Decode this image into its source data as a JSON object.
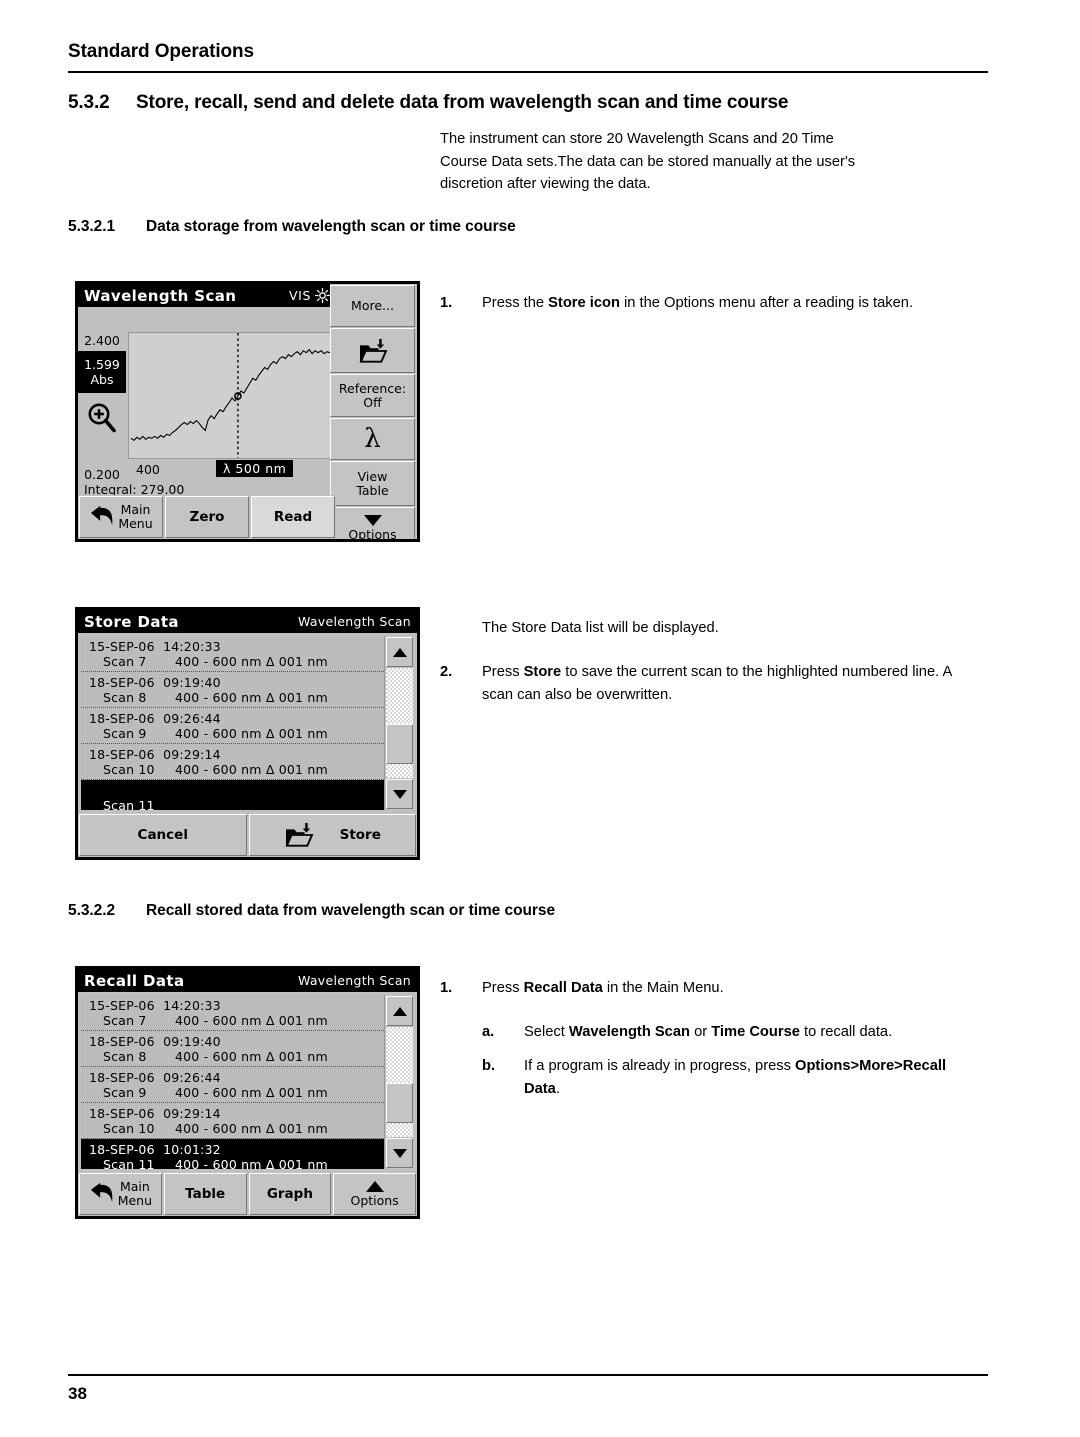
{
  "header": {
    "running_head": "Standard Operations"
  },
  "sections": {
    "s532": {
      "number": "5.3.2",
      "title": "Store, recall, send and delete data from wavelength scan and time course"
    },
    "s5321": {
      "number": "5.3.2.1",
      "title": "Data storage from wavelength scan or time course"
    },
    "s5322": {
      "number": "5.3.2.2",
      "title": "Recall stored data from wavelength scan or time course"
    }
  },
  "intro": {
    "line1": "The instrument can store 20 Wavelength Scans and 20 Time",
    "line2": "Course Data sets.The data can be stored manually at the user's",
    "line3": "discretion after viewing the data."
  },
  "steps_storage": {
    "step1": {
      "marker": "1.",
      "t1": "Press the ",
      "b1": "Store icon",
      "t2": " in the Options menu after a reading is taken."
    },
    "note": "The Store Data list will be displayed.",
    "step2": {
      "marker": "2.",
      "t1": "Press ",
      "b1": "Store",
      "t2": " to save the current scan to the highlighted numbered line. A scan can also be overwritten."
    }
  },
  "steps_recall": {
    "step1": {
      "marker": "1.",
      "t1": "Press ",
      "b1": "Recall Data",
      "t2": " in the Main Menu."
    },
    "stepa": {
      "marker": "a.",
      "t1": "Select ",
      "b1": "Wavelength Scan",
      "t2": " or ",
      "b2": "Time Course",
      "t3": " to recall data."
    },
    "stepb": {
      "marker": "b.",
      "t1": "If a program is already in progress, press ",
      "b1": "Options>More>Recall Data",
      "t2": "."
    }
  },
  "footer": {
    "page_number": "38"
  },
  "screen_wavelength_scan": {
    "title": "Wavelength Scan",
    "mode": "VIS",
    "lamp_icon": "sun-icon",
    "axis": {
      "y_top": "2.400",
      "y_cursor_value": "1.599",
      "y_cursor_unit": "Abs",
      "y_bottom": "0.200",
      "x_start": "400"
    },
    "zoom_icon": "magnifier-plus-icon",
    "cursor_readout": "λ 500 nm",
    "integral": "Integral: 279.00",
    "softkeys": [
      {
        "label": "More...",
        "icon": null
      },
      {
        "label": "",
        "icon": "store-folder-icon"
      },
      {
        "label": "Reference:\nOff",
        "line1": "Reference:",
        "line2": "Off",
        "icon": null
      },
      {
        "label": "λ",
        "icon": "lambda-icon"
      },
      {
        "label": "View\nTable",
        "line1": "View",
        "line2": "Table",
        "icon": null
      },
      {
        "label": "Options",
        "icon": "triangle-down-icon"
      }
    ],
    "buttons": {
      "main_menu_l1": "Main",
      "main_menu_l2": "Menu",
      "zero": "Zero",
      "read": "Read",
      "options": "Options"
    },
    "chart_data": {
      "type": "line",
      "title": "Wavelength Scan",
      "xlabel": "nm",
      "ylabel": "Abs",
      "xlim": [
        400,
        600
      ],
      "ylim": [
        0.2,
        2.4
      ],
      "cursor_x": 500,
      "cursor_y": 1.599,
      "grid": false,
      "legend": null,
      "x": [
        400,
        405,
        410,
        415,
        420,
        425,
        430,
        435,
        440,
        445,
        450,
        455,
        460,
        465,
        470,
        475,
        480,
        485,
        490,
        495,
        500,
        505,
        510,
        515,
        520,
        525,
        530,
        535,
        540,
        545,
        550,
        555,
        560,
        565,
        570,
        575,
        580,
        585,
        590,
        595,
        600
      ],
      "values": [
        0.42,
        0.44,
        0.43,
        0.46,
        0.45,
        0.47,
        0.5,
        0.53,
        0.58,
        0.62,
        0.66,
        0.7,
        0.64,
        0.58,
        0.68,
        0.76,
        0.82,
        0.88,
        0.96,
        1.06,
        1.16,
        1.28,
        1.4,
        1.5,
        1.6,
        1.67,
        1.73,
        1.8,
        1.86,
        1.9,
        1.94,
        1.97,
        1.99,
        2.01,
        1.98,
        2.02,
        1.99,
        2.01,
        1.97,
        2.0,
        1.99
      ]
    }
  },
  "screen_store_data": {
    "title": "Store Data",
    "subtitle": "Wavelength Scan",
    "scrollbar": {
      "up_icon": "triangle-up-icon",
      "down_icon": "triangle-down-icon"
    },
    "rows": [
      {
        "date": "15-SEP-06",
        "time": "14:20:33",
        "name": "Scan 7",
        "range": "400 - 600 nm Δ 001 nm",
        "selected": false
      },
      {
        "date": "18-SEP-06",
        "time": "09:19:40",
        "name": "Scan 8",
        "range": "400 - 600 nm Δ 001 nm",
        "selected": false
      },
      {
        "date": "18-SEP-06",
        "time": "09:26:44",
        "name": "Scan 9",
        "range": "400 - 600 nm Δ 001 nm",
        "selected": false
      },
      {
        "date": "18-SEP-06",
        "time": "09:29:14",
        "name": "Scan 10",
        "range": "400 - 600 nm Δ 001 nm",
        "selected": false
      },
      {
        "date": "",
        "time": "",
        "name": "Scan 11",
        "range": "",
        "selected": true
      }
    ],
    "buttons": {
      "cancel": "Cancel",
      "store": "Store",
      "store_icon": "store-folder-icon"
    }
  },
  "screen_recall_data": {
    "title": "Recall Data",
    "subtitle": "Wavelength Scan",
    "scrollbar": {
      "up_icon": "triangle-up-icon",
      "down_icon": "triangle-down-icon"
    },
    "rows": [
      {
        "date": "15-SEP-06",
        "time": "14:20:33",
        "name": "Scan 7",
        "range": "400 - 600 nm Δ 001 nm",
        "selected": false
      },
      {
        "date": "18-SEP-06",
        "time": "09:19:40",
        "name": "Scan 8",
        "range": "400 - 600 nm Δ 001 nm",
        "selected": false
      },
      {
        "date": "18-SEP-06",
        "time": "09:26:44",
        "name": "Scan 9",
        "range": "400 - 600 nm Δ 001 nm",
        "selected": false
      },
      {
        "date": "18-SEP-06",
        "time": "09:29:14",
        "name": "Scan 10",
        "range": "400 - 600 nm Δ 001 nm",
        "selected": false
      },
      {
        "date": "18-SEP-06",
        "time": "10:01:32",
        "name": "Scan 11",
        "range": "400 - 600 nm Δ 001 nm",
        "selected": true
      }
    ],
    "buttons": {
      "main_menu_l1": "Main",
      "main_menu_l2": "Menu",
      "table": "Table",
      "graph": "Graph",
      "options": "Options"
    }
  }
}
